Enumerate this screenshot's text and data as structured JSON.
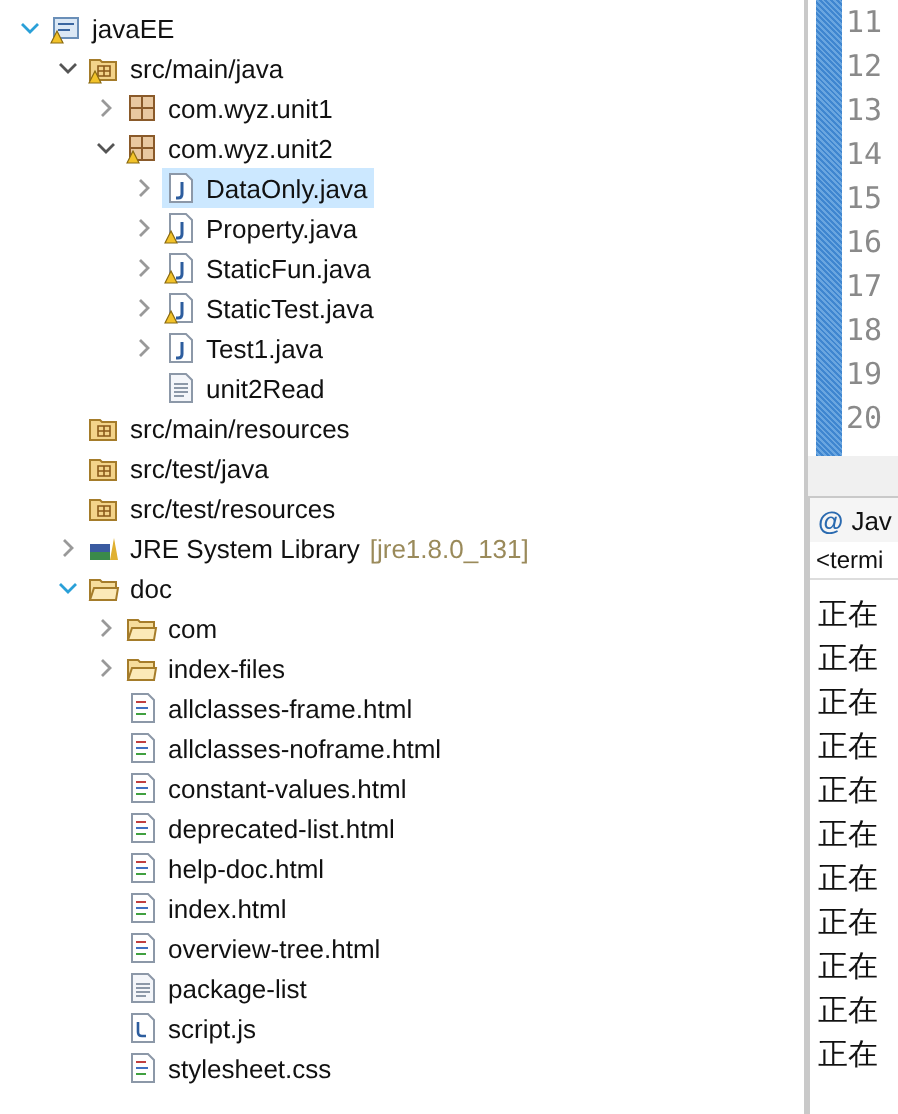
{
  "project_tree": [
    {
      "label": "javaEE",
      "kind": "project",
      "expanded": true,
      "warning": true,
      "selected": false,
      "children": [
        {
          "label": "src/main/java",
          "kind": "source-folder",
          "expanded": true,
          "warning": true,
          "selected": false,
          "children": [
            {
              "label": "com.wyz.unit1",
              "kind": "package",
              "expanded": false,
              "warning": false,
              "selected": false
            },
            {
              "label": "com.wyz.unit2",
              "kind": "package",
              "expanded": true,
              "warning": true,
              "selected": false,
              "children": [
                {
                  "label": "DataOnly.java",
                  "kind": "java-file",
                  "expanded": false,
                  "warning": false,
                  "selected": true
                },
                {
                  "label": "Property.java",
                  "kind": "java-file",
                  "expanded": false,
                  "warning": true,
                  "selected": false
                },
                {
                  "label": "StaticFun.java",
                  "kind": "java-file",
                  "expanded": false,
                  "warning": true,
                  "selected": false
                },
                {
                  "label": "StaticTest.java",
                  "kind": "java-file",
                  "expanded": false,
                  "warning": true,
                  "selected": false
                },
                {
                  "label": "Test1.java",
                  "kind": "java-file",
                  "expanded": false,
                  "warning": false,
                  "selected": false
                },
                {
                  "label": "unit2Read",
                  "kind": "text-file",
                  "warning": false,
                  "selected": false
                }
              ]
            }
          ]
        },
        {
          "label": "src/main/resources",
          "kind": "source-folder",
          "warning": false,
          "selected": false
        },
        {
          "label": "src/test/java",
          "kind": "source-folder",
          "warning": false,
          "selected": false
        },
        {
          "label": "src/test/resources",
          "kind": "source-folder",
          "warning": false,
          "selected": false
        },
        {
          "label": "JRE System Library",
          "decoration": "[jre1.8.0_131]",
          "kind": "library",
          "expanded": false,
          "warning": false,
          "selected": false
        },
        {
          "label": "doc",
          "kind": "folder",
          "expanded": true,
          "warning": false,
          "selected": false,
          "children": [
            {
              "label": "com",
              "kind": "folder",
              "expanded": false,
              "warning": false,
              "selected": false
            },
            {
              "label": "index-files",
              "kind": "folder",
              "expanded": false,
              "warning": false,
              "selected": false
            },
            {
              "label": "allclasses-frame.html",
              "kind": "html-file",
              "warning": false,
              "selected": false
            },
            {
              "label": "allclasses-noframe.html",
              "kind": "html-file",
              "warning": false,
              "selected": false
            },
            {
              "label": "constant-values.html",
              "kind": "html-file",
              "warning": false,
              "selected": false
            },
            {
              "label": "deprecated-list.html",
              "kind": "html-file",
              "warning": false,
              "selected": false
            },
            {
              "label": "help-doc.html",
              "kind": "html-file",
              "warning": false,
              "selected": false
            },
            {
              "label": "index.html",
              "kind": "html-file",
              "warning": false,
              "selected": false
            },
            {
              "label": "overview-tree.html",
              "kind": "html-file",
              "warning": false,
              "selected": false
            },
            {
              "label": "package-list",
              "kind": "text-file",
              "warning": false,
              "selected": false
            },
            {
              "label": "script.js",
              "kind": "js-file",
              "warning": false,
              "selected": false
            },
            {
              "label": "stylesheet.css",
              "kind": "html-file",
              "warning": false,
              "selected": false
            }
          ]
        }
      ]
    }
  ],
  "editor": {
    "line_numbers": [
      "11",
      "12",
      "13",
      "14",
      "15",
      "16",
      "17",
      "18",
      "19",
      "20"
    ]
  },
  "console": {
    "tab_icon": "@",
    "tab": "Jav",
    "header": "<termi",
    "lines": [
      "正在",
      "正在",
      "正在",
      "正在",
      "正在",
      "正在",
      "正在",
      "正在",
      "正在",
      "正在",
      "正在"
    ]
  }
}
